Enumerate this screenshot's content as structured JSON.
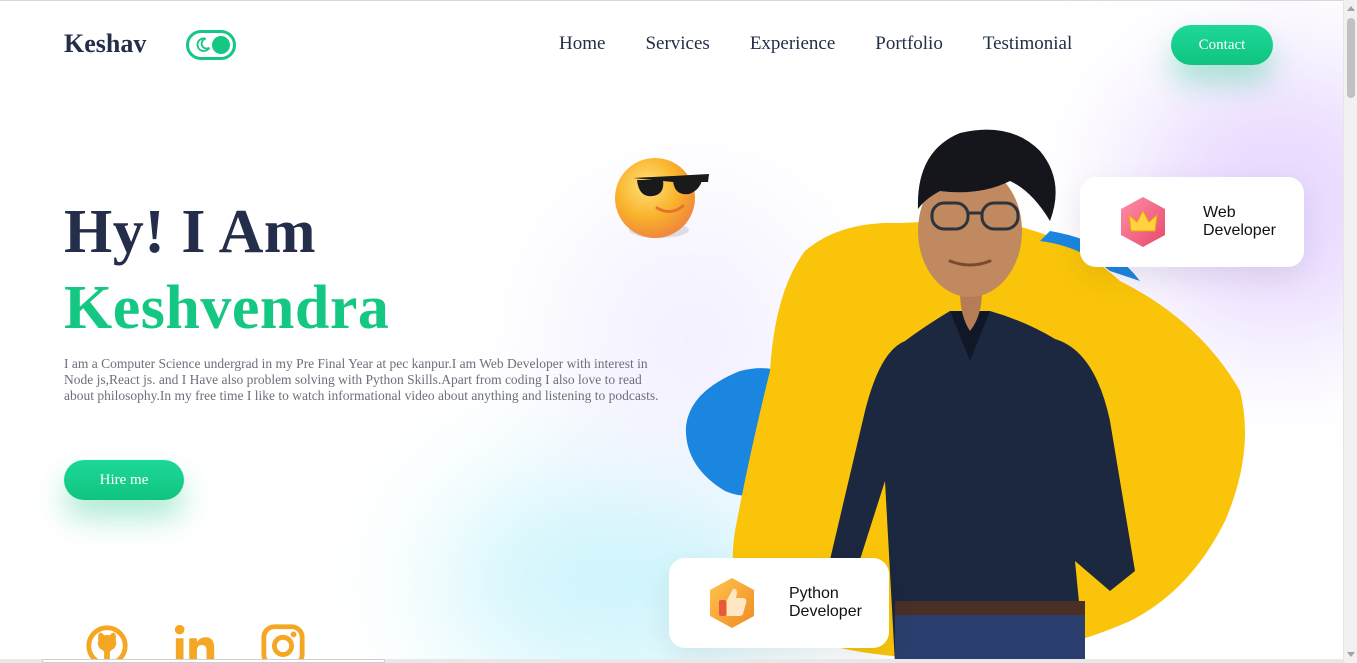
{
  "brand": {
    "name": "Keshav"
  },
  "theme_toggle": {
    "icon": "moon-icon",
    "state": "dark-mode-off"
  },
  "nav": {
    "links": [
      "Home",
      "Services",
      "Experience",
      "Portfolio",
      "Testimonial"
    ],
    "contact_label": "Contact"
  },
  "intro": {
    "greeting": "Hy! I Am",
    "name": "Keshvendra",
    "bio": "I am a Computer Science undergrad in my Pre Final Year at pec kanpur.I am Web Developer with interest in Node js,React js. and I Have also problem solving with Python Skills.Apart from coding I also love to read about philosophy.In my free time I like to watch informational video about anything and listening to podcasts.",
    "hire_label": "Hire me"
  },
  "social": [
    "github-icon",
    "linkedin-icon",
    "instagram-icon"
  ],
  "cards": {
    "web": {
      "line1": "Web",
      "line2": "Developer",
      "icon": "crown-icon"
    },
    "python": {
      "line1": "Python",
      "line2": "Developer",
      "icon": "thumbs-up-icon"
    }
  },
  "colors": {
    "accent": "#14c783",
    "heading": "#242d49",
    "blob_yellow": "#f9c409",
    "blob_blue": "#1b86e0",
    "icon_orange": "#f5a623"
  }
}
